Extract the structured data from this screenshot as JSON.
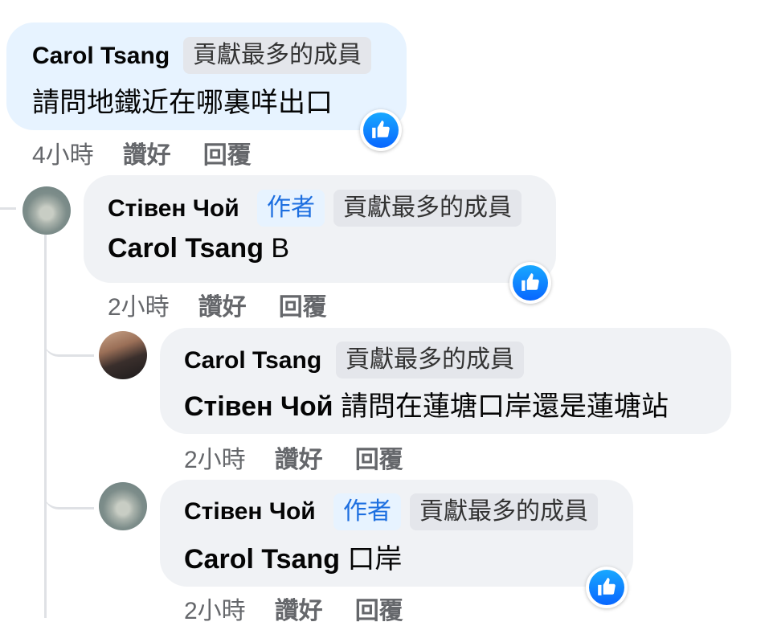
{
  "comments": [
    {
      "author": "Carol Tsang",
      "badge_top": "貢獻最多的成員",
      "text": "請問地鐵近在哪裏咩出口",
      "time": "4小時",
      "like_label": "讚好",
      "reply_label": "回覆"
    },
    {
      "author": "Стівен Чой",
      "badge_author": "作者",
      "badge_top": "貢獻最多的成員",
      "mention": "Carol Tsang",
      "text": " B",
      "time": "2小時",
      "like_label": "讚好",
      "reply_label": "回覆"
    },
    {
      "author": "Carol Tsang",
      "badge_top": "貢獻最多的成員",
      "mention": "Стівен Чой",
      "text": " 請問在蓮塘口岸還是蓮塘站",
      "time": "2小時",
      "like_label": "讚好",
      "reply_label": "回覆"
    },
    {
      "author": "Стівен Чой",
      "badge_author": "作者",
      "badge_top": "貢獻最多的成員",
      "mention": "Carol Tsang",
      "text": " 口岸",
      "time": "2小時",
      "like_label": "讚好",
      "reply_label": "回覆"
    }
  ],
  "colors": {
    "bubble": "#f0f2f5",
    "bubble_highlight": "#e7f3ff",
    "author_badge_text": "#1d6fe0",
    "like_blue": "#0866ff",
    "muted_text": "#65676b"
  },
  "icons": {
    "reaction": "thumbs-up-icon"
  }
}
